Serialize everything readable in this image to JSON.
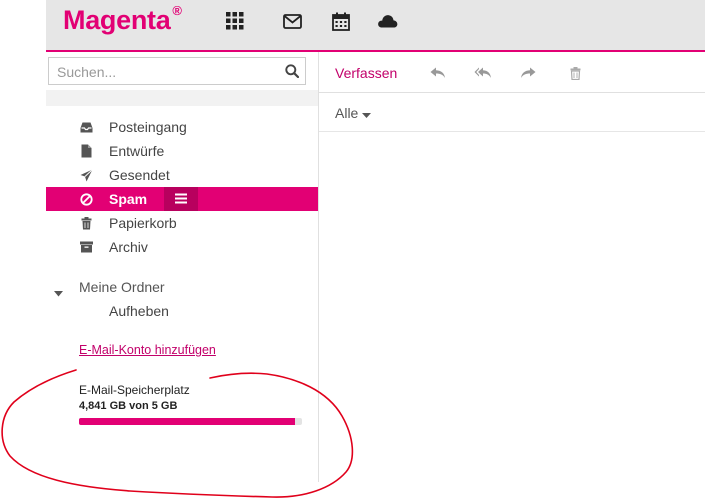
{
  "header": {
    "logo_text": "Magenta",
    "logo_mark": "®",
    "icons": [
      "apps-grid-icon",
      "mail-icon",
      "calendar-icon",
      "cloud-icon"
    ]
  },
  "search": {
    "placeholder": "Suchen...",
    "icon": "search-icon"
  },
  "folders": [
    {
      "label": "Posteingang",
      "icon": "inbox-icon"
    },
    {
      "label": "Entwürfe",
      "icon": "file-icon"
    },
    {
      "label": "Gesendet",
      "icon": "paper-plane-icon"
    },
    {
      "label": "Spam",
      "icon": "ban-icon",
      "active": true
    },
    {
      "label": "Papierkorb",
      "icon": "trash-icon"
    },
    {
      "label": "Archiv",
      "icon": "archive-icon"
    }
  ],
  "my_folders": {
    "label": "Meine Ordner",
    "unsubscribe_label": "Aufheben"
  },
  "add_account_link": "E-Mail-Konto hinzufügen",
  "storage": {
    "title": "E-Mail-Speicherplatz",
    "text": "4,841 GB von 5 GB",
    "used_fraction": 0.9682
  },
  "toolbar": {
    "compose_label": "Verfassen",
    "icons": [
      "reply-icon",
      "reply-all-icon",
      "forward-icon",
      "delete-icon"
    ]
  },
  "filter": {
    "label": "Alle"
  },
  "colors": {
    "brand": "#e20074",
    "brand_dark": "#b8005e",
    "annotation": "#e0001b"
  }
}
